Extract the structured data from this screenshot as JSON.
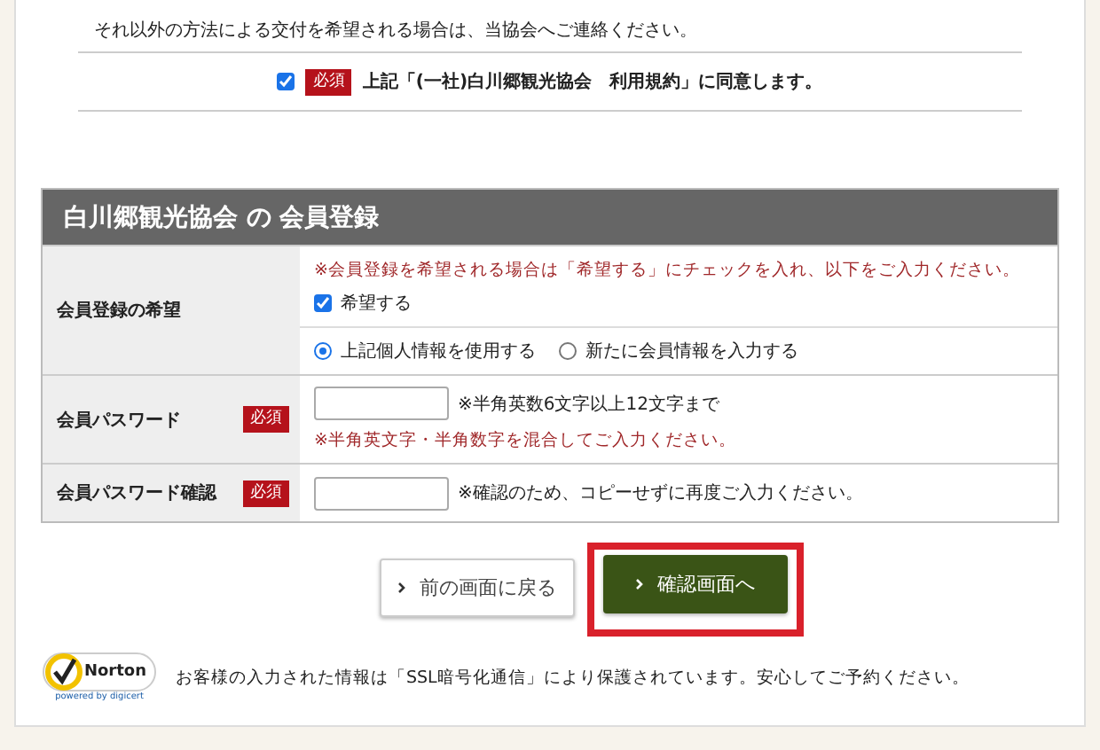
{
  "notice": "それ以外の方法による交付を希望される場合は、当協会へご連絡ください。",
  "agreement": {
    "checked": true,
    "badge": "必須",
    "label": "上記「(一社)白川郷観光協会　利用規約」に同意します。"
  },
  "section": {
    "title": "白川郷観光協会 の 会員登録",
    "rows": [
      {
        "kind": "wish",
        "label": "会員登録の希望",
        "note": "※会員登録を希望される場合は「希望する」にチェックを入れ、以下をご入力ください。",
        "checkbox": {
          "label": "希望する",
          "checked": true
        },
        "radios": [
          {
            "label": "上記個人情報を使用する",
            "selected": true
          },
          {
            "label": "新たに会員情報を入力する",
            "selected": false
          }
        ]
      },
      {
        "kind": "password",
        "label": "会員パスワード",
        "badge": "必須",
        "hint": "※半角英数6文字以上12文字まで",
        "note": "※半角英文字・半角数字を混合してご入力ください。"
      },
      {
        "kind": "password",
        "label": "会員パスワード確認",
        "badge": "必須",
        "hint": "※確認のため、コピーせずに再度ご入力ください。"
      }
    ]
  },
  "buttons": [
    {
      "label": "前の画面に戻る",
      "kind": "secondary",
      "highlighted": false
    },
    {
      "label": "確認画面へ",
      "kind": "primary",
      "highlighted": true
    }
  ],
  "footer": {
    "logo": {
      "name": "Norton",
      "sub": "powered by digicert"
    },
    "text": "お客様の入力された情報は「SSL暗号化通信」により保護されています。安心してご予約ください。"
  }
}
